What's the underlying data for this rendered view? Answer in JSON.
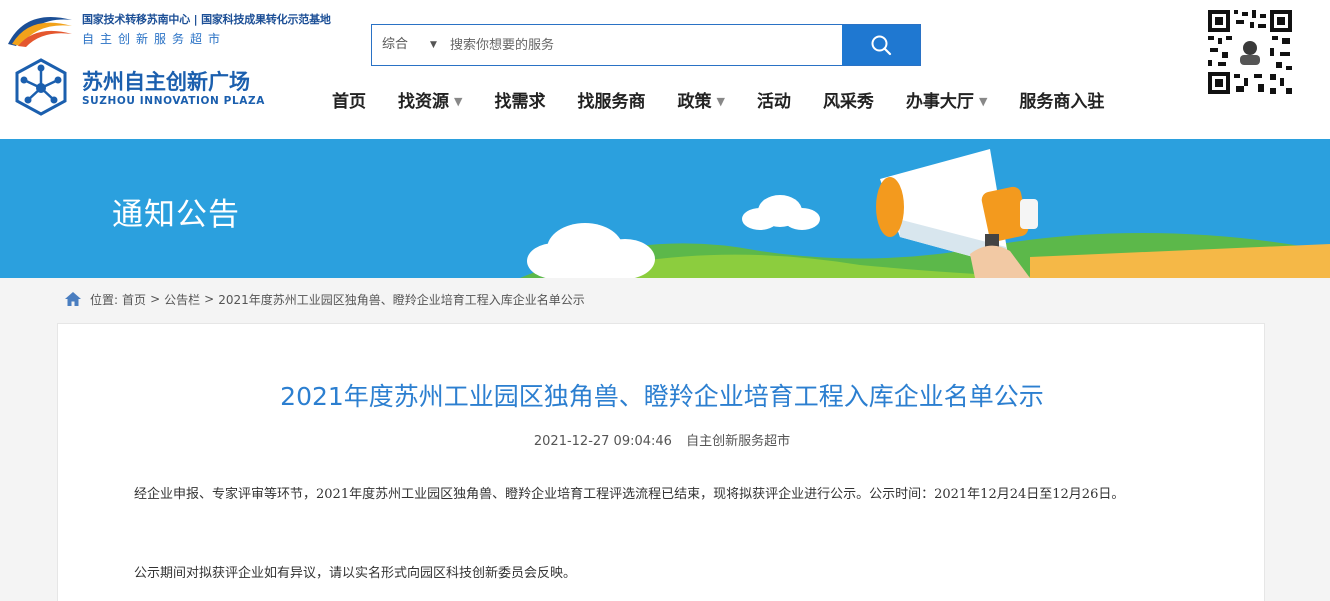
{
  "header": {
    "org_line1": "国家技术转移苏南中心 | 国家科技成果转化示范基地",
    "org_line2": "自主创新服务超市",
    "logo_cn": "苏州自主创新广场",
    "logo_en": "SUZHOU INNOVATION PLAZA",
    "qr_icon": "qr-code-icon"
  },
  "search": {
    "category": "综合",
    "placeholder": "搜索你想要的服务",
    "button_icon": "search-icon"
  },
  "nav": {
    "items": [
      {
        "label": "首页",
        "dropdown": false
      },
      {
        "label": "找资源",
        "dropdown": true
      },
      {
        "label": "找需求",
        "dropdown": false
      },
      {
        "label": "找服务商",
        "dropdown": false
      },
      {
        "label": "政策",
        "dropdown": true
      },
      {
        "label": "活动",
        "dropdown": false
      },
      {
        "label": "风采秀",
        "dropdown": false
      },
      {
        "label": "办事大厅",
        "dropdown": true
      },
      {
        "label": "服务商入驻",
        "dropdown": false
      }
    ]
  },
  "banner": {
    "title": "通知公告",
    "illustration": "megaphone-icon"
  },
  "breadcrumb": {
    "prefix": "位置:",
    "home": "首页",
    "section": "公告栏",
    "current": "2021年度苏州工业园区独角兽、瞪羚企业培育工程入库企业名单公示",
    "separator": ">"
  },
  "article": {
    "title": "2021年度苏州工业园区独角兽、瞪羚企业培育工程入库企业名单公示",
    "date": "2021-12-27 09:04:46",
    "source": "自主创新服务超市",
    "paragraphs": [
      "经企业申报、专家评审等环节，2021年度苏州工业园区独角兽、瞪羚企业培育工程评选流程已结束，现将拟获评企业进行公示。公示时间：2021年12月24日至12月26日。",
      "公示期间对拟获评企业如有异议，请以实名形式向园区科技创新委员会反映。"
    ]
  },
  "colors": {
    "brand_blue": "#1f78d1",
    "banner_blue": "#2ba0de",
    "title_blue": "#2c7fd0",
    "megaphone_orange": "#f39a1e"
  }
}
